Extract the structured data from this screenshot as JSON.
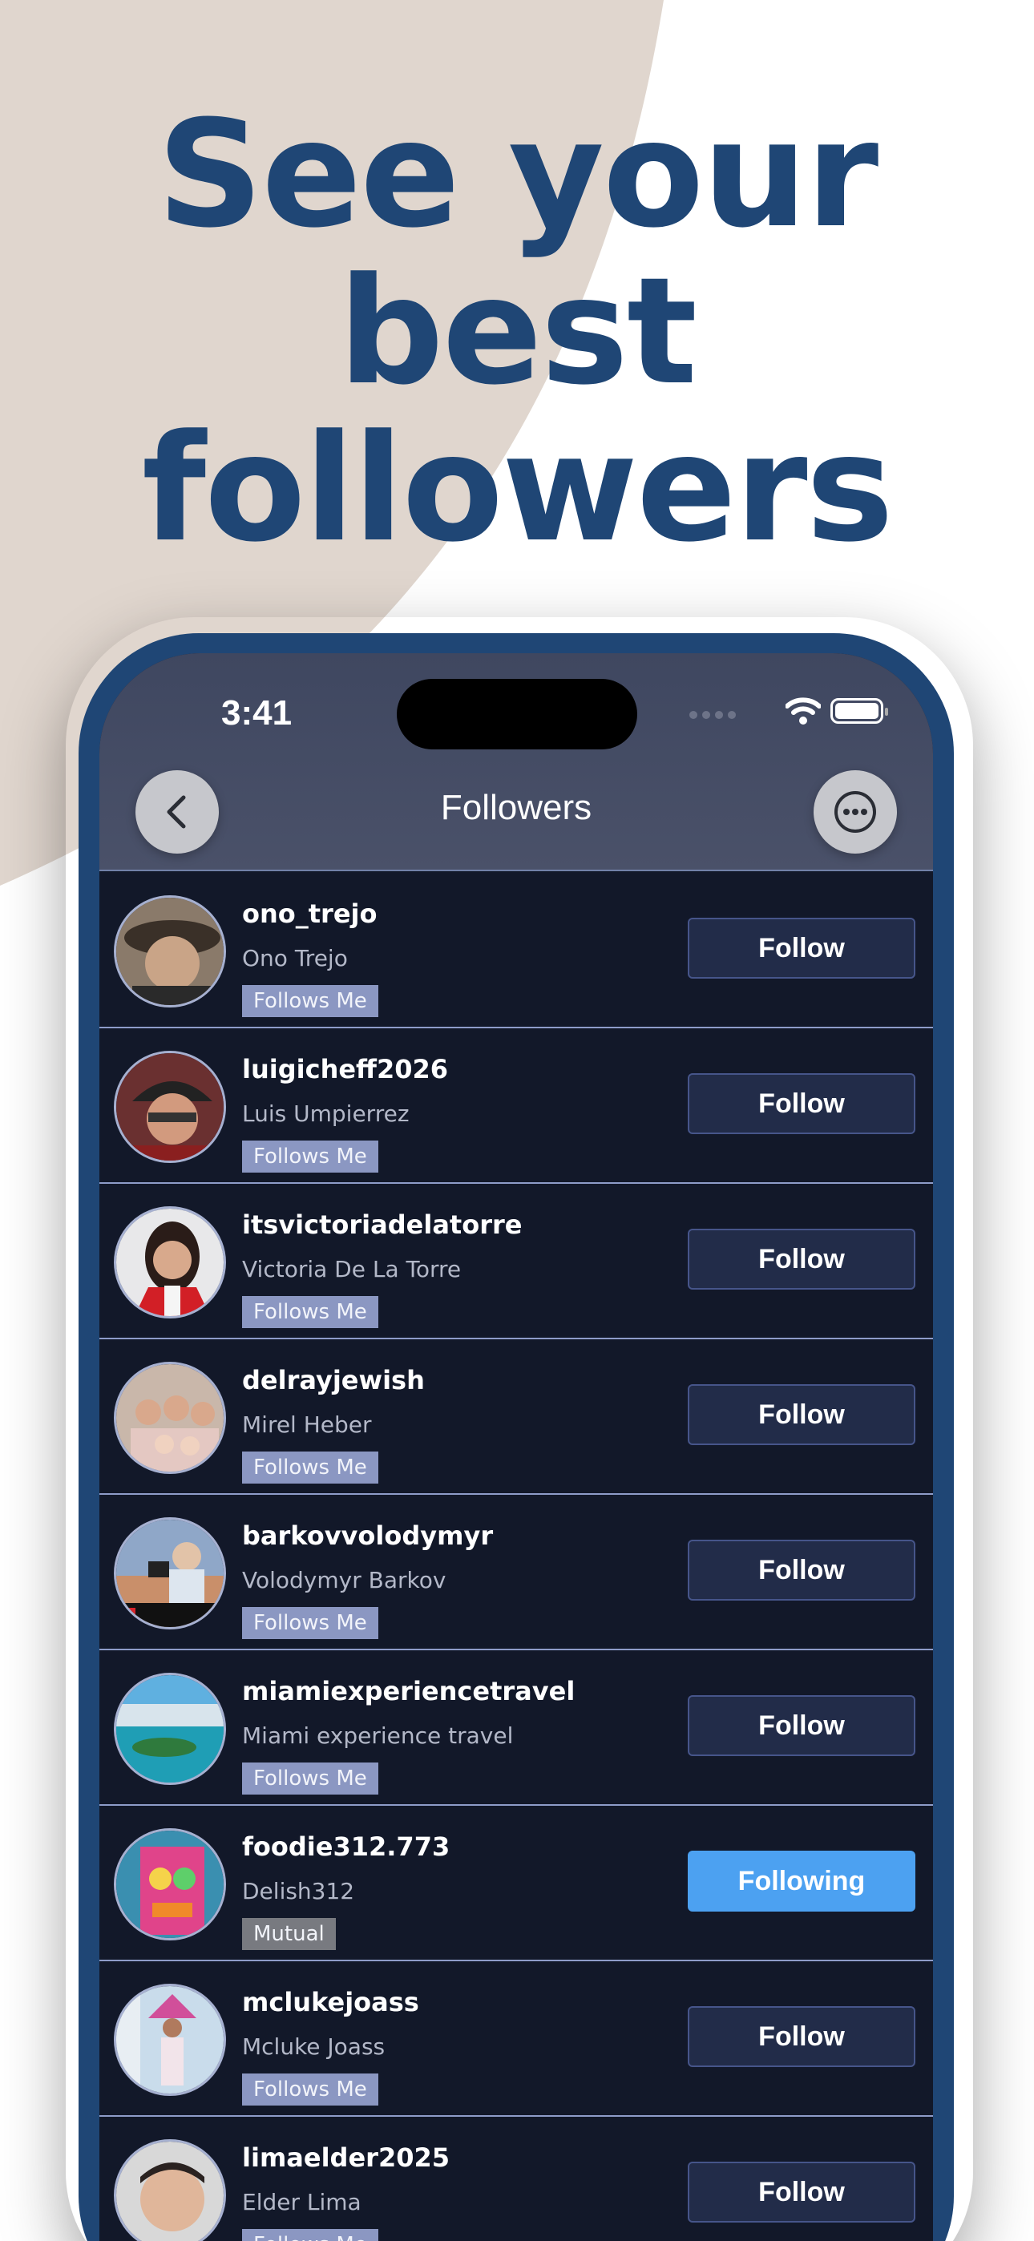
{
  "headline": {
    "line1": "See your",
    "line2": "best",
    "line3": "followers"
  },
  "colors": {
    "headline": "#1f4675",
    "blob": "#e0d6ce",
    "phone_frame": "#1f4675",
    "screen_bg": "#121829",
    "following_button": "#4ca1f1",
    "tag_follows_me": "#8b97c2",
    "tag_mutual": "#787a80"
  },
  "status_bar": {
    "time": "3:41",
    "icons": [
      "signal-dots-icon",
      "wifi-icon",
      "battery-icon"
    ]
  },
  "nav": {
    "title": "Followers",
    "back_icon": "chevron-left-icon",
    "more_icon": "ellipsis-circle-icon"
  },
  "followers": [
    {
      "username": "ono_trejo",
      "name": "Ono Trejo",
      "tag": "Follows Me",
      "button": "Follow"
    },
    {
      "username": "luigicheff2026",
      "name": "Luis Umpierrez",
      "tag": "Follows Me",
      "button": "Follow"
    },
    {
      "username": "itsvictoriadelatorre",
      "name": "Victoria De La Torre",
      "tag": "Follows Me",
      "button": "Follow"
    },
    {
      "username": "delrayjewish",
      "name": "Mirel Heber",
      "tag": "Follows Me",
      "button": "Follow"
    },
    {
      "username": "barkovvolodymyr",
      "name": "Volodymyr Barkov",
      "tag": "Follows Me",
      "button": "Follow"
    },
    {
      "username": "miamiexperiencetravel",
      "name": "Miami experience travel",
      "tag": "Follows Me",
      "button": "Follow"
    },
    {
      "username": "foodie312.773",
      "name": "Delish312",
      "tag": "Mutual",
      "button": "Following"
    },
    {
      "username": "mclukejoass",
      "name": "Mcluke Joass",
      "tag": "Follows Me",
      "button": "Follow"
    },
    {
      "username": "limaelder2025",
      "name": "Elder Lima",
      "tag": "Follows Me",
      "button": "Follow"
    }
  ]
}
